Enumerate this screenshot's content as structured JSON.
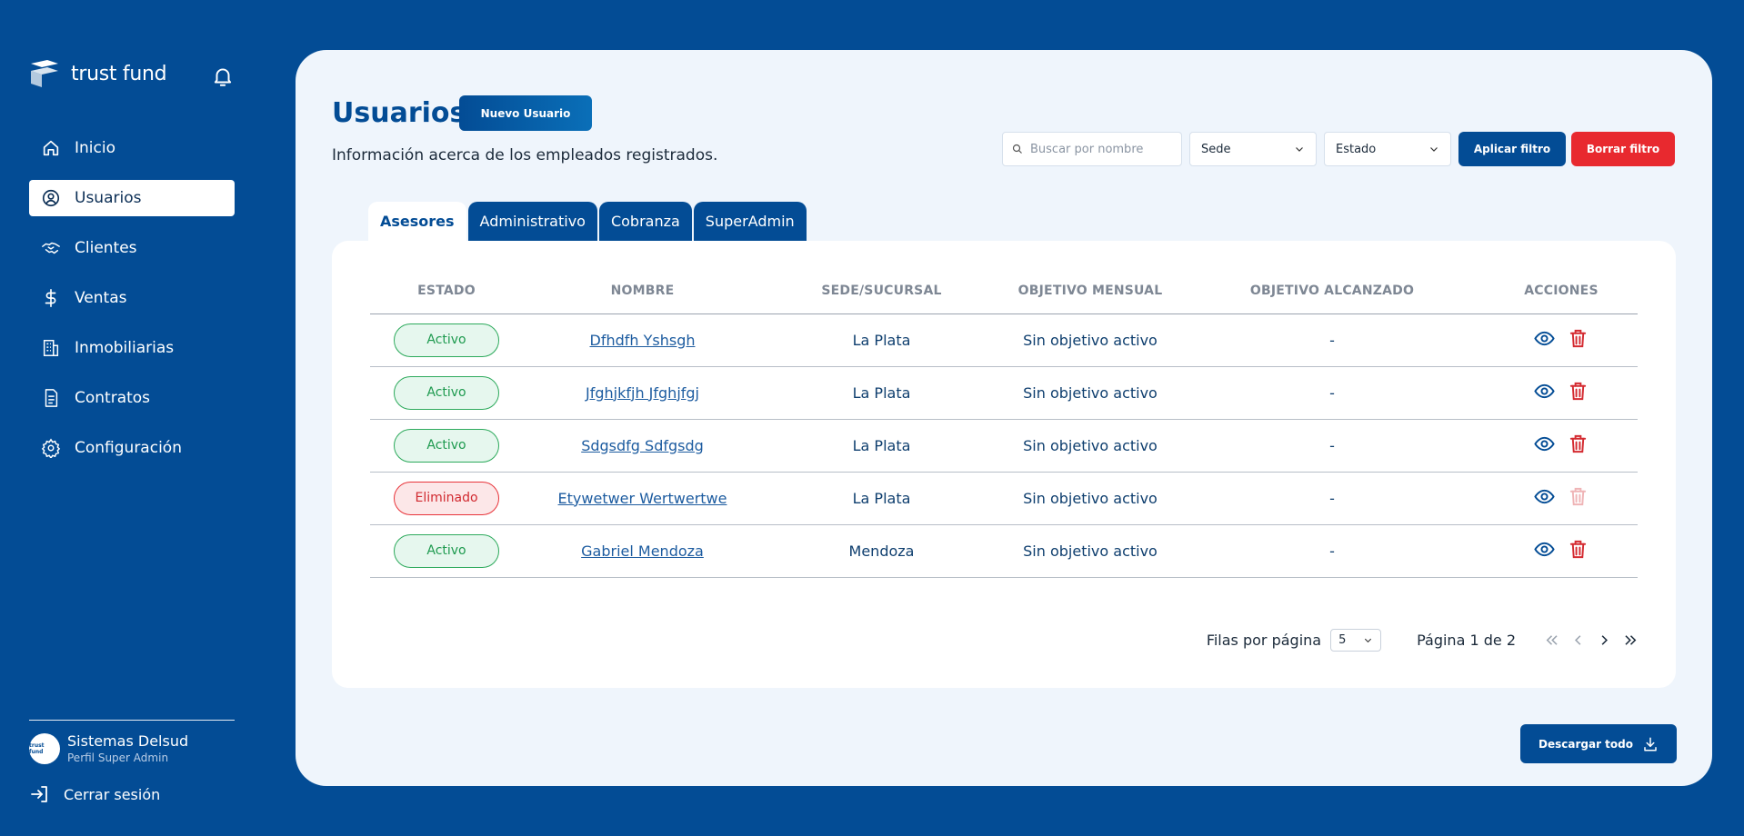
{
  "brand": {
    "name": "trust fund"
  },
  "sidebar": {
    "items": [
      {
        "label": "Inicio",
        "icon": "home-icon",
        "active": false
      },
      {
        "label": "Usuarios",
        "icon": "user-circle-icon",
        "active": true
      },
      {
        "label": "Clientes",
        "icon": "handshake-icon",
        "active": false
      },
      {
        "label": "Ventas",
        "icon": "dollar-icon",
        "active": false
      },
      {
        "label": "Inmobiliarias",
        "icon": "building-icon",
        "active": false
      },
      {
        "label": "Contratos",
        "icon": "document-icon",
        "active": false
      },
      {
        "label": "Configuración",
        "icon": "gear-icon",
        "active": false
      }
    ],
    "profile": {
      "name": "Sistemas Delsud",
      "role": "Perfil Super Admin",
      "avatar_text": "trust fund"
    },
    "logout_label": "Cerrar sesión"
  },
  "main": {
    "title": "Usuarios",
    "new_button": "Nuevo Usuario",
    "subtitle": "Información acerca de los empleados registrados.",
    "filters": {
      "search_placeholder": "Buscar por nombre",
      "sede": "Sede",
      "estado": "Estado",
      "apply": "Aplicar filtro",
      "clear": "Borrar filtro"
    },
    "tabs": [
      "Asesores",
      "Administrativo",
      "Cobranza",
      "SuperAdmin"
    ],
    "active_tab": "Asesores",
    "table": {
      "columns": [
        "ESTADO",
        "NOMBRE",
        "SEDE/SUCURSAL",
        "OBJETIVO MENSUAL",
        "OBJETIVO ALCANZADO",
        "ACCIONES"
      ],
      "rows": [
        {
          "estado": "Activo",
          "nombre": "Dfhdfh Yshsgh",
          "sede": "La Plata",
          "objetivo_mensual": "Sin objetivo activo",
          "objetivo_alcanzado": "-"
        },
        {
          "estado": "Activo",
          "nombre": "Jfghjkfjh Jfghjfgj",
          "sede": "La Plata",
          "objetivo_mensual": "Sin objetivo activo",
          "objetivo_alcanzado": "-"
        },
        {
          "estado": "Activo",
          "nombre": "Sdgsdfg Sdfgsdg",
          "sede": "La Plata",
          "objetivo_mensual": "Sin objetivo activo",
          "objetivo_alcanzado": "-"
        },
        {
          "estado": "Eliminado",
          "nombre": "Etywetwer Wertwertwe",
          "sede": "La Plata",
          "objetivo_mensual": "Sin objetivo activo",
          "objetivo_alcanzado": "-"
        },
        {
          "estado": "Activo",
          "nombre": "Gabriel Mendoza",
          "sede": "Mendoza",
          "objetivo_mensual": "Sin objetivo activo",
          "objetivo_alcanzado": "-"
        }
      ]
    },
    "pagination": {
      "rows_label": "Filas por página",
      "rows_value": "5",
      "page_info": "Página 1 de 2"
    },
    "download_label": "Descargar todo"
  },
  "colors": {
    "background": "#034C95",
    "panel": "#EFF5FC",
    "primary": "#034C95",
    "danger": "#E8292F",
    "active_badge": "#2DAA5C",
    "deleted_badge": "#E8343A"
  }
}
